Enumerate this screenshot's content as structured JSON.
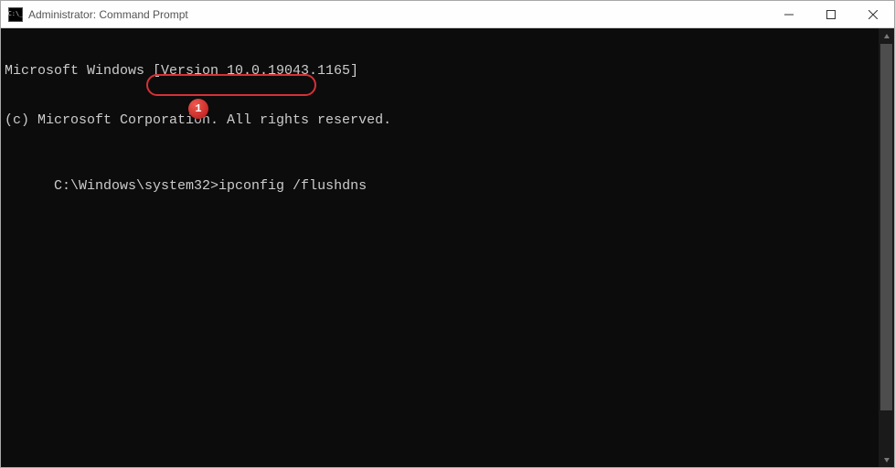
{
  "titlebar": {
    "title": "Administrator: Command Prompt"
  },
  "terminal": {
    "line1": "Microsoft Windows [Version 10.0.19043.1165]",
    "line2": "(c) Microsoft Corporation. All rights reserved.",
    "blank": "",
    "prompt": "C:\\Windows\\system32>",
    "command": "ipconfig /flushdns"
  },
  "annotation": {
    "badge": "1"
  }
}
